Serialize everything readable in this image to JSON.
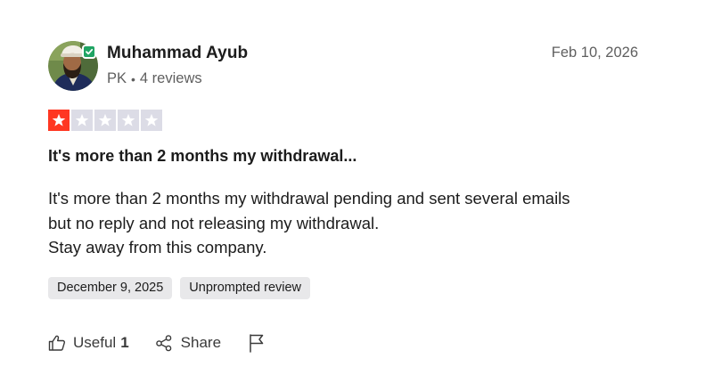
{
  "reviewer": {
    "name": "Muhammad Ayub",
    "country": "PK",
    "separator": "•",
    "review_count": "4 reviews",
    "verified_icon": "verified-check-icon"
  },
  "review": {
    "date": "Feb 10, 2026",
    "rating": 1,
    "rating_max": 5,
    "star_filled_color": "#ff3722",
    "star_empty_color": "#dcdce6",
    "title": "It's more than 2 months my withdrawal...",
    "body_lines": [
      "It's more than 2 months my withdrawal pending and sent several emails",
      "but no reply and not releasing my withdrawal.",
      "Stay away from this company."
    ],
    "experience_date": "December 9, 2025",
    "review_type": "Unprompted review"
  },
  "actions": {
    "useful_label": "Useful",
    "useful_count": "1",
    "share_label": "Share",
    "flag_icon": "flag-icon"
  }
}
